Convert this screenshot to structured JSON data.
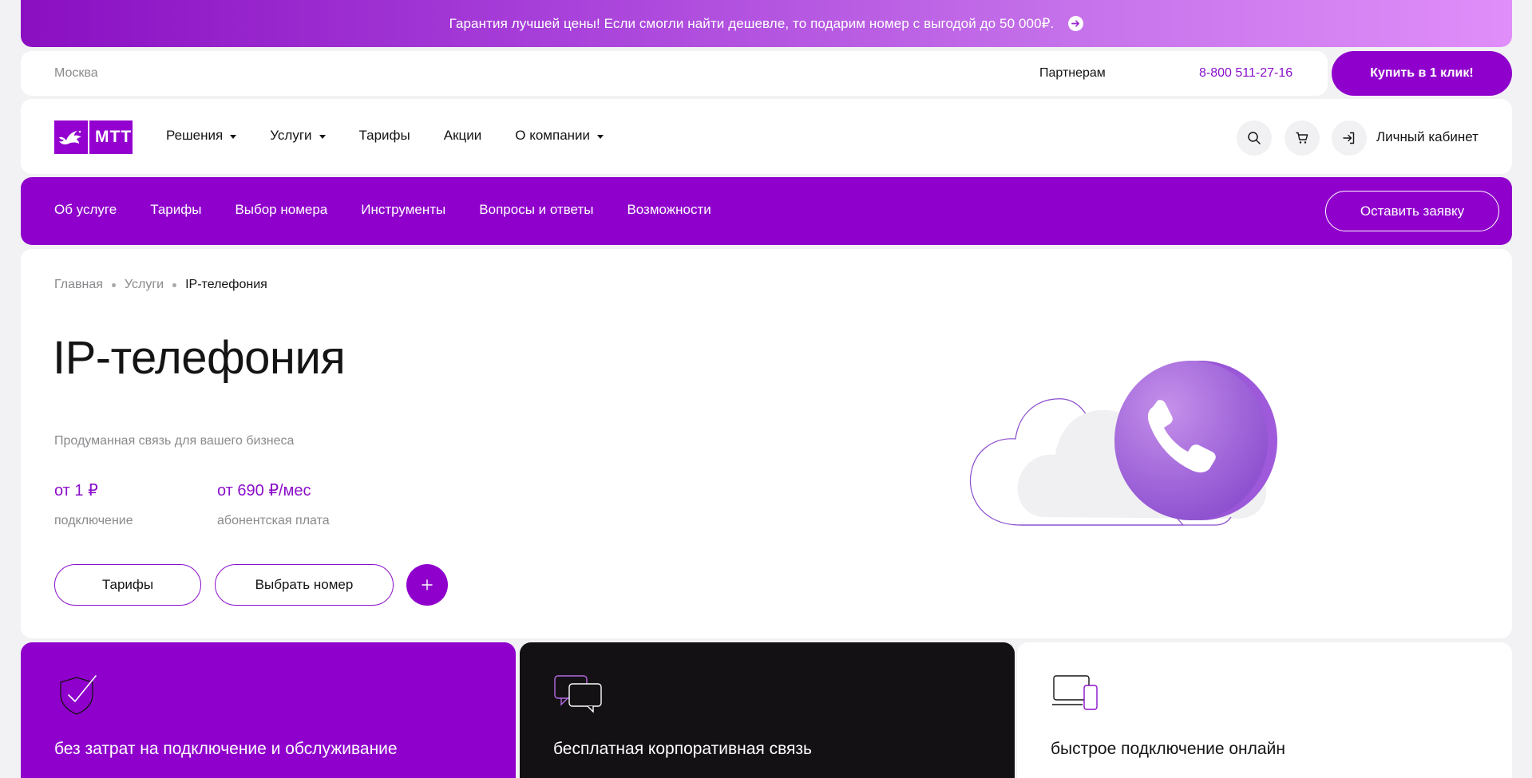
{
  "promo": {
    "text": "Гарантия лучшей цены! Если смогли найти дешевле, то подарим номер с выгодой до 50 000₽."
  },
  "topbar": {
    "city": "Москва",
    "partners": "Партнерам",
    "phone": "8-800 511-27-16",
    "buy_label": "Купить в 1 клик!"
  },
  "header": {
    "logo_text": "МТТ",
    "nav": [
      {
        "label": "Решения",
        "has_dropdown": true
      },
      {
        "label": "Услуги",
        "has_dropdown": true
      },
      {
        "label": "Тарифы",
        "has_dropdown": false
      },
      {
        "label": "Акции",
        "has_dropdown": false
      },
      {
        "label": "О компании",
        "has_dropdown": true
      }
    ],
    "icons": [
      "search-icon",
      "cart-icon",
      "login-icon"
    ],
    "account_label": "Личный кабинет"
  },
  "subnav": {
    "links": [
      "Об услуге",
      "Тарифы",
      "Выбор номера",
      "Инструменты",
      "Вопросы и ответы",
      "Возможности"
    ],
    "apply_label": "Оставить заявку"
  },
  "breadcrumb": [
    "Главная",
    "Услуги",
    "IP-телефония"
  ],
  "hero": {
    "title": "IP-телефония",
    "subtitle": "Продуманная связь для вашего бизнеса",
    "prices": [
      {
        "value": "от 1 ₽",
        "label": "подключение"
      },
      {
        "value": "от 690 ₽/мес",
        "label": "абонентская плата"
      }
    ],
    "buttons": {
      "tariffs": "Тарифы",
      "choose_number": "Выбрать номер"
    }
  },
  "cards": [
    {
      "title": "без затрат на подключение и обслуживание",
      "icon": "shield-check-icon"
    },
    {
      "title": "бесплатная корпоративная связь",
      "icon": "chat-bubbles-icon"
    },
    {
      "title": "быстрое подключение онлайн",
      "icon": "devices-icon"
    }
  ],
  "colors": {
    "brand": "#9000cc",
    "accent_text": "#8b0fca",
    "dark_card": "#141114"
  }
}
